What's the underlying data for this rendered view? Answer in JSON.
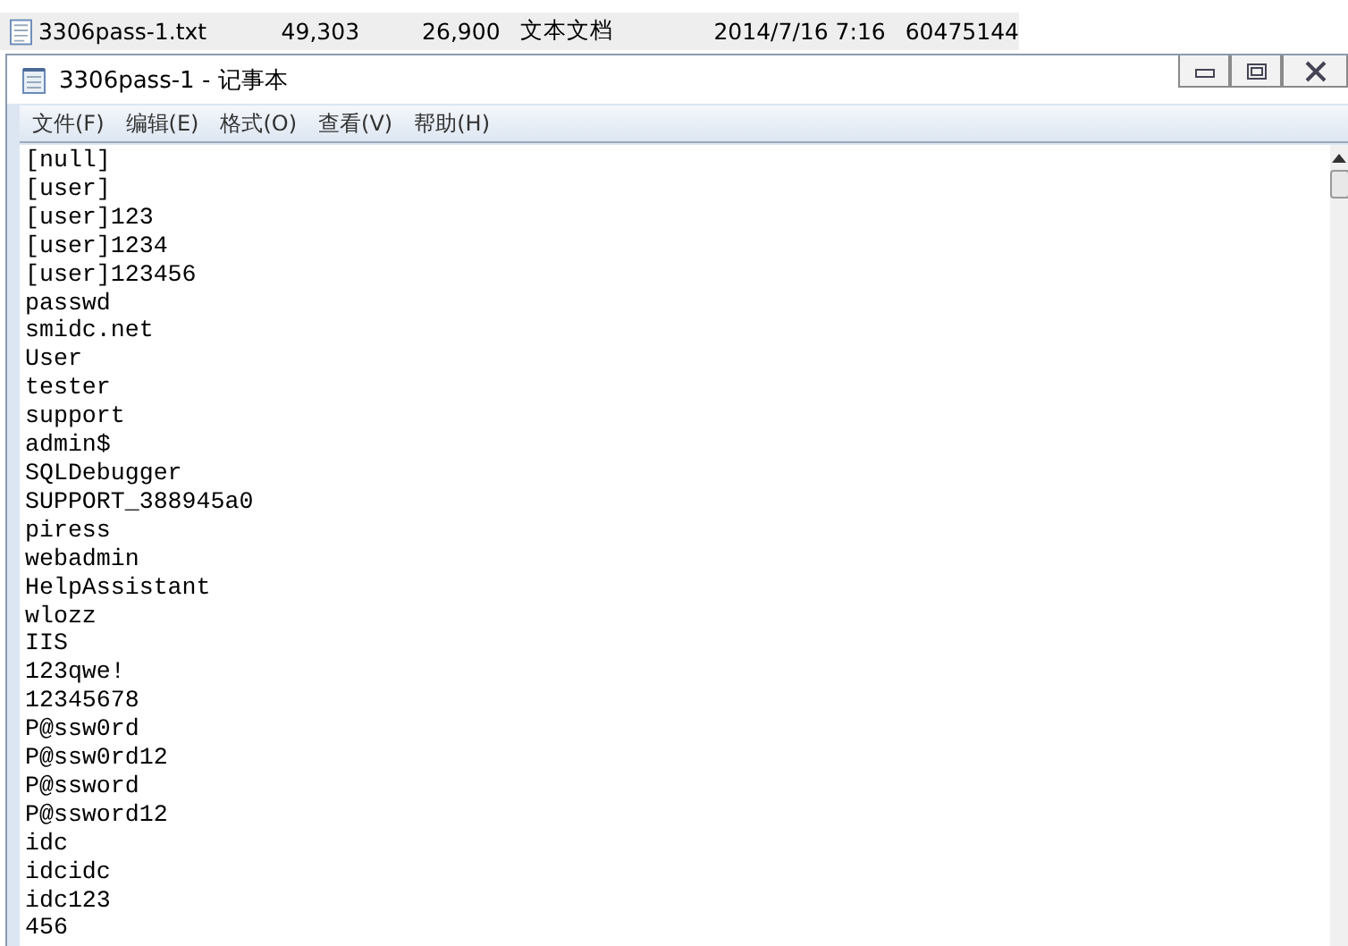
{
  "file_row": {
    "name": "3306pass-1.txt",
    "column_2": "49,303",
    "column_3": "26,900",
    "type": "文本文档",
    "modified": "2014/7/16 7:16",
    "column_6": "60475144"
  },
  "window": {
    "title": "3306pass-1 - 记事本"
  },
  "menu": [
    "文件(F)",
    "编辑(E)",
    "格式(O)",
    "查看(V)",
    "帮助(H)"
  ],
  "lines": [
    "[null]",
    "[user]",
    "[user]123",
    "[user]1234",
    "[user]123456",
    "passwd",
    "smidc.net",
    "User",
    "tester",
    "support",
    "admin$",
    "SQLDebugger",
    "SUPPORT_388945a0",
    "piress",
    "webadmin",
    "HelpAssistant",
    "wlozz",
    "IIS",
    "123qwe!",
    "12345678",
    "P@ssw0rd",
    "P@ssw0rd12",
    "P@ssword",
    "P@ssword12",
    "idc",
    "idcidc",
    "idc123",
    "456"
  ]
}
